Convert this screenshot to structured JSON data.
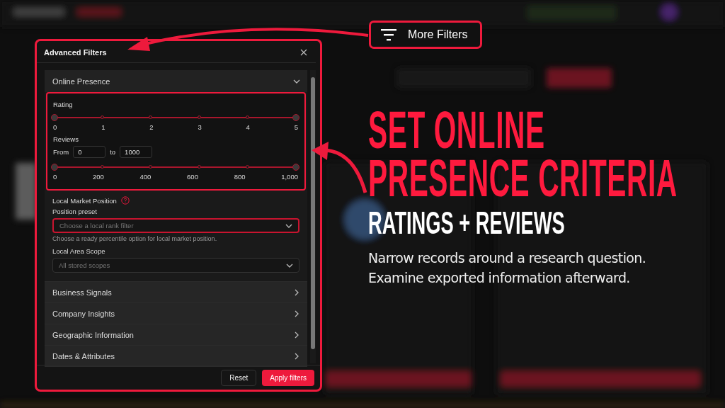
{
  "callout": {
    "label": "More Filters"
  },
  "headline": {
    "lines": [
      "SET ONLINE",
      "PRESENCE CRITERIA"
    ],
    "subtitle": "RATINGS + REVIEWS",
    "description": [
      "Narrow records around a research question.",
      "Examine exported information afterward."
    ]
  },
  "dialog": {
    "title": "Advanced Filters",
    "sections": [
      {
        "title": "Online Presence",
        "expanded": true
      },
      {
        "title": "Business Signals",
        "expanded": false
      },
      {
        "title": "Company Insights",
        "expanded": false
      },
      {
        "title": "Geographic Information",
        "expanded": false
      },
      {
        "title": "Dates & Attributes",
        "expanded": false
      }
    ],
    "online_presence": {
      "highlighted": true,
      "rating": {
        "label": "Rating",
        "thumbs": [
          {
            "level": 0
          },
          {
            "level": 1
          }
        ],
        "ticks": [
          "0",
          "1",
          "2",
          "3",
          "4",
          "5"
        ]
      },
      "reviews": {
        "label": "Reviews",
        "from_label": "From",
        "from_value": "0",
        "to_label": "to",
        "to_value": "1000",
        "thumbs": [
          {
            "level": 0
          },
          {
            "level": 1
          }
        ],
        "ticks": [
          "0",
          "200",
          "400",
          "600",
          "800",
          "1,000"
        ]
      },
      "local_market": {
        "label": "Local Market Position",
        "position_preset": {
          "label": "Position preset",
          "placeholder": "Choose a local rank filter",
          "focused": true,
          "help": "Choose a ready percentile option for local market position."
        },
        "area_scope": {
          "label": "Local Area Scope",
          "placeholder": "All stored scopes",
          "focused": false
        }
      }
    },
    "buttons": [
      {
        "label": "Reset",
        "kind": "secondary"
      },
      {
        "label": "Apply filters",
        "kind": "primary"
      }
    ]
  }
}
